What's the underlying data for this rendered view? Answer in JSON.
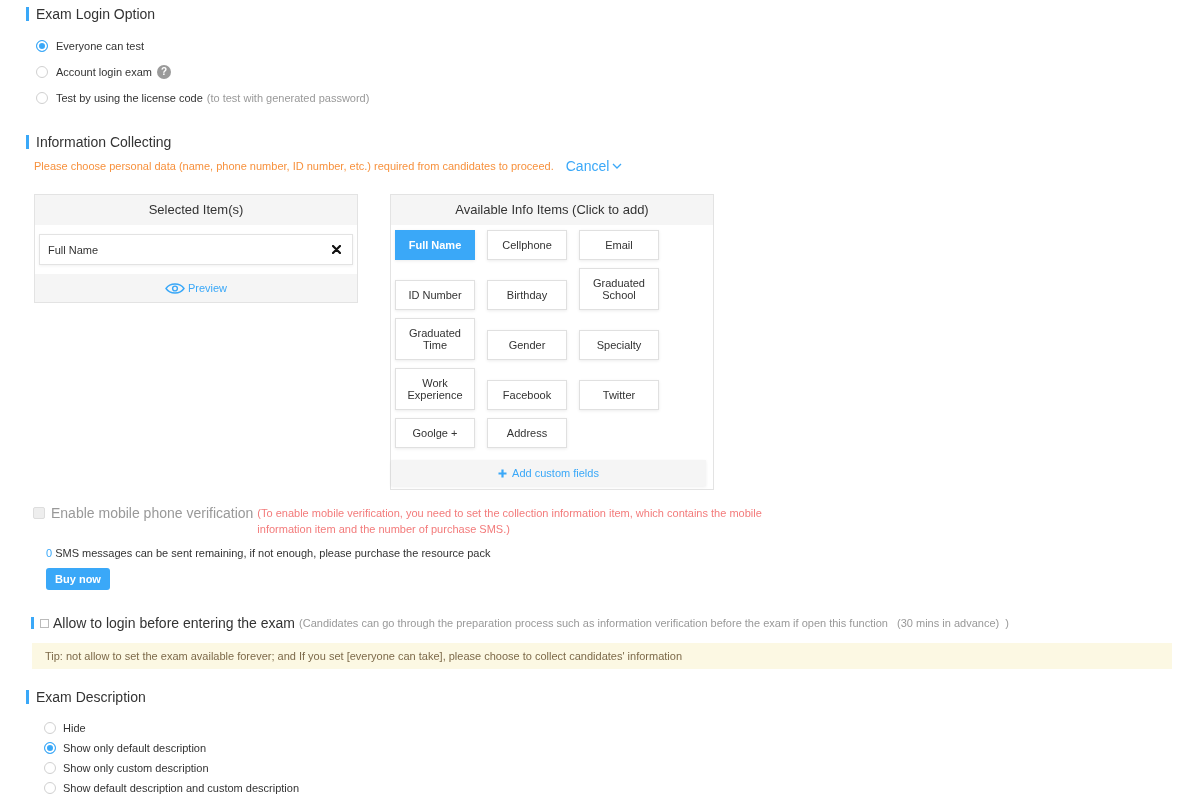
{
  "exam_login_option": {
    "title": "Exam Login Option",
    "options": [
      {
        "label": "Everyone can test",
        "selected": true
      },
      {
        "label": "Account login exam",
        "help": "?",
        "selected": false
      },
      {
        "label": "Test by using the license code",
        "note": "(to test with generated password)",
        "selected": false
      }
    ]
  },
  "information_collecting": {
    "title": "Information Collecting",
    "hint": "Please choose personal data (name, phone number, ID number, etc.) required from candidates to proceed.",
    "cancel": "Cancel",
    "selected_items": {
      "title": "Selected Item(s)",
      "items": [
        "Full Name"
      ],
      "preview": "Preview"
    },
    "available_items": {
      "title": "Available Info Items (Click to add)",
      "items": [
        {
          "label": "Full Name",
          "selected": true
        },
        {
          "label": "Cellphone",
          "selected": false
        },
        {
          "label": "Email",
          "selected": false
        },
        {
          "label": "ID Number",
          "selected": false
        },
        {
          "label": "Birthday",
          "selected": false
        },
        {
          "label": "Graduated School",
          "selected": false
        },
        {
          "label": "Graduated Time",
          "selected": false
        },
        {
          "label": "Gender",
          "selected": false
        },
        {
          "label": "Specialty",
          "selected": false
        },
        {
          "label": "Work Experience",
          "selected": false
        },
        {
          "label": "Facebook",
          "selected": false
        },
        {
          "label": "Twitter",
          "selected": false
        },
        {
          "label": "Goolge +",
          "selected": false
        },
        {
          "label": "Address",
          "selected": false
        }
      ],
      "add_custom": "Add custom fields"
    }
  },
  "mobile_verification": {
    "label": "Enable mobile phone verification",
    "checked": false,
    "disabled": true,
    "note": "(To enable mobile verification, you need to set the collection information item, which contains the mobile information item and the number of purchase SMS.)",
    "sms_count": "0",
    "sms_text": "SMS messages can be sent remaining, if not enough, please purchase the resource pack",
    "buy_button": "Buy now"
  },
  "pre_login": {
    "label": "Allow to login before entering the exam",
    "checked": false,
    "note": "(Candidates can go through the preparation process such as information verification before the exam if open this function   (30 mins in advance)  )"
  },
  "tip": "Tip: not allow to set the exam available forever; and If you set [everyone can take], please choose to collect candidates' information",
  "exam_description": {
    "title": "Exam Description",
    "options": [
      {
        "label": "Hide",
        "selected": false
      },
      {
        "label": "Show only default description",
        "selected": true
      },
      {
        "label": "Show only custom description",
        "selected": false
      },
      {
        "label": "Show default description and custom description",
        "selected": false
      }
    ]
  }
}
